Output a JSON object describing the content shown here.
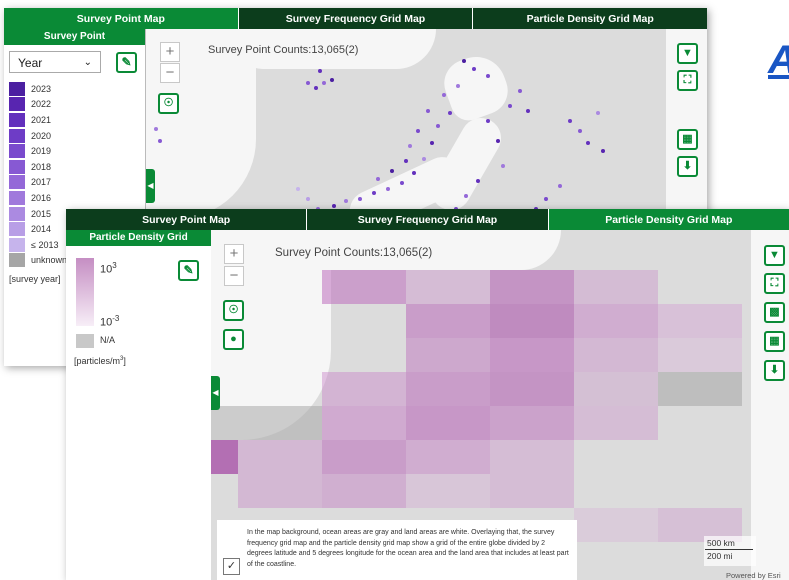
{
  "colors": {
    "accent": "#0a8a36",
    "tab_bar": "#0c3d1c",
    "ocean": "#dcdcdc",
    "land": "#f6f6f6",
    "title_blue": "#1a56c4"
  },
  "corner_title": "A",
  "back_window": {
    "tabs": [
      {
        "label": "Survey Point Map",
        "active": true
      },
      {
        "label": "Survey Frequency Grid Map",
        "active": false
      },
      {
        "label": "Particle Density Grid Map",
        "active": false
      }
    ],
    "panel_title": "Survey Point",
    "select_value": "Year",
    "legend": [
      {
        "label": "2023",
        "color": "#4b1fa1"
      },
      {
        "label": "2022",
        "color": "#5825b0"
      },
      {
        "label": "2021",
        "color": "#6330bd"
      },
      {
        "label": "2020",
        "color": "#6e3cc6"
      },
      {
        "label": "2019",
        "color": "#7a4acd"
      },
      {
        "label": "2018",
        "color": "#8759d3"
      },
      {
        "label": "2017",
        "color": "#9468d8"
      },
      {
        "label": "2016",
        "color": "#a079dc"
      },
      {
        "label": "2015",
        "color": "#ab8ae1"
      },
      {
        "label": "2014",
        "color": "#b89ee6"
      },
      {
        "label": "≤ 2013",
        "color": "#c6b4ec"
      },
      {
        "label": "unknown",
        "color": "#a6a6a6"
      }
    ],
    "unit_label": "[survey year]",
    "counts": "Survey Point Counts:13,065(2)"
  },
  "front_window": {
    "tabs": [
      {
        "label": "Survey Point Map",
        "active": false
      },
      {
        "label": "Survey Frequency Grid Map",
        "active": false
      },
      {
        "label": "Particle Density Grid Map",
        "active": true
      }
    ],
    "panel_title": "Particle Density Grid",
    "legend_high": "10",
    "legend_high_exp": "3",
    "legend_low": "10",
    "legend_low_exp": "-3",
    "na_label": "N/A",
    "unit_label_main": "[particles/m",
    "unit_label_exp": "3",
    "unit_label_close": "]",
    "counts": "Survey Point Counts:13,065(2)",
    "note": "In the map background, ocean areas are gray and land areas are white. Overlaying that, the survey frequency grid map and the particle density grid map show a grid of the entire globe divided by 2 degrees latitude and 5 degrees longitude for the ocean area and the land area that includes at least part of the coastline.",
    "scale_km": "500 km",
    "scale_mi": "200 mi",
    "attribution": "Powered by Esri"
  },
  "icons": {
    "draw": "pencil-icon",
    "filter": "filter-icon",
    "extent": "extent-icon",
    "table": "table-icon",
    "download": "download-icon",
    "chart": "bar-chart-icon",
    "globe": "globe-icon",
    "location": "location-pin-icon",
    "collapse": "collapse-arrow-icon",
    "check": "check-icon"
  }
}
